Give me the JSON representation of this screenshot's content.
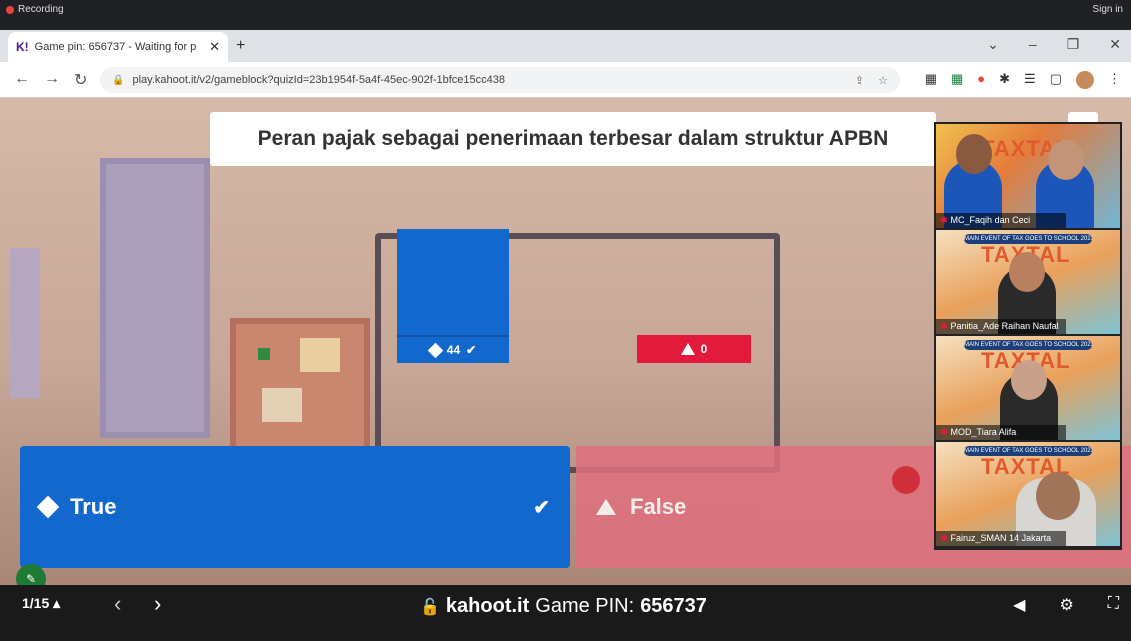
{
  "browser": {
    "recording": "Recording",
    "sign_in": "Sign in",
    "tab_title": "Game pin: 656737 - Waiting for p",
    "tab_favicon": "K!",
    "url": "play.kahoot.it/v2/gameblock?quizId=23b1954f-5a4f-45ec-902f-1bfce15cc438"
  },
  "question": "Peran pajak sebagai penerimaan terbesar dalam struktur APBN",
  "results": {
    "true_count": "44",
    "false_count": "0"
  },
  "answers": {
    "true_label": "True",
    "false_label": "False"
  },
  "participants": [
    {
      "name": "MC_Faqih dan Ceci"
    },
    {
      "name": "Panitia_Ade Raihan Naufal"
    },
    {
      "name": "MOD_Tiara Alifa"
    },
    {
      "name": "Fairuz_SMAN 14 Jakarta"
    }
  ],
  "footer": {
    "counter": "1/15",
    "domain": "kahoot.it",
    "pin_label": "Game PIN:",
    "pin_value": "656737"
  },
  "colors": {
    "blue": "#1368ce",
    "red": "#e21b3c"
  }
}
